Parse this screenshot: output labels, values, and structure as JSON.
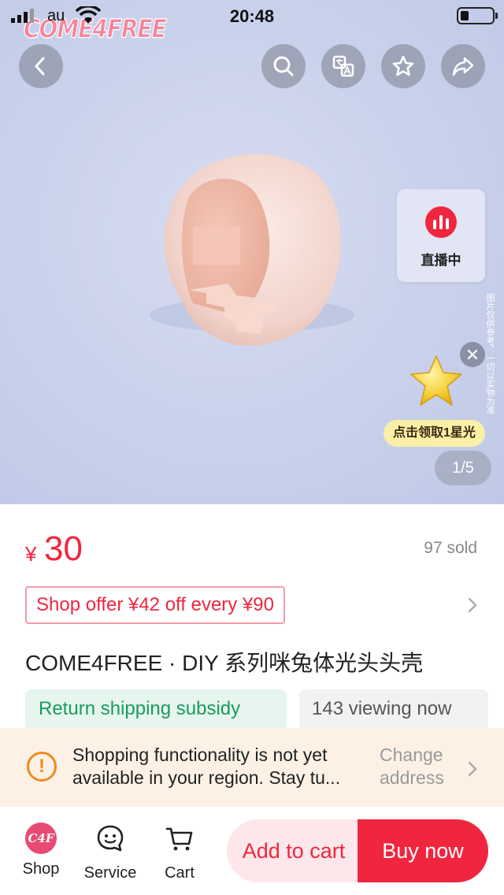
{
  "status_bar": {
    "carrier": "au",
    "time": "20:48"
  },
  "brand_logo": "COME4FREE",
  "hero": {
    "live_label": "直播中",
    "disclaimer": "图片仅供参考，一切以实物为准",
    "promo_label": "点击领取1星光",
    "image_counter": "1/5"
  },
  "product": {
    "currency": "¥",
    "price": "30",
    "sold": "97 sold",
    "offer": "Shop offer ¥42 off every ¥90",
    "title": "COME4FREE · DIY 系列咪兔体光头头壳",
    "return_chip": "Return shipping subsidy",
    "viewing_chip": "143 viewing now"
  },
  "notice": {
    "line1": "Shopping functionality is not yet",
    "line2": "available in your region. Stay tu...",
    "link_line1": "Change",
    "link_line2": "address"
  },
  "bottom_bar": {
    "shop_label": "Shop",
    "shop_avatar_text": "C4F",
    "service_label": "Service",
    "cart_label": "Cart",
    "add_to_cart": "Add to cart",
    "buy_now": "Buy now"
  },
  "colors": {
    "accent": "#f0263f",
    "green": "#1a9a60",
    "notice_bg": "#fdf1e6",
    "warning": "#f08a1a"
  },
  "icons": [
    "back-icon",
    "search-icon",
    "translate-icon",
    "star-icon",
    "share-icon",
    "live-bars-icon",
    "close-icon",
    "chevron-right-icon",
    "warning-icon",
    "service-icon",
    "cart-icon"
  ]
}
